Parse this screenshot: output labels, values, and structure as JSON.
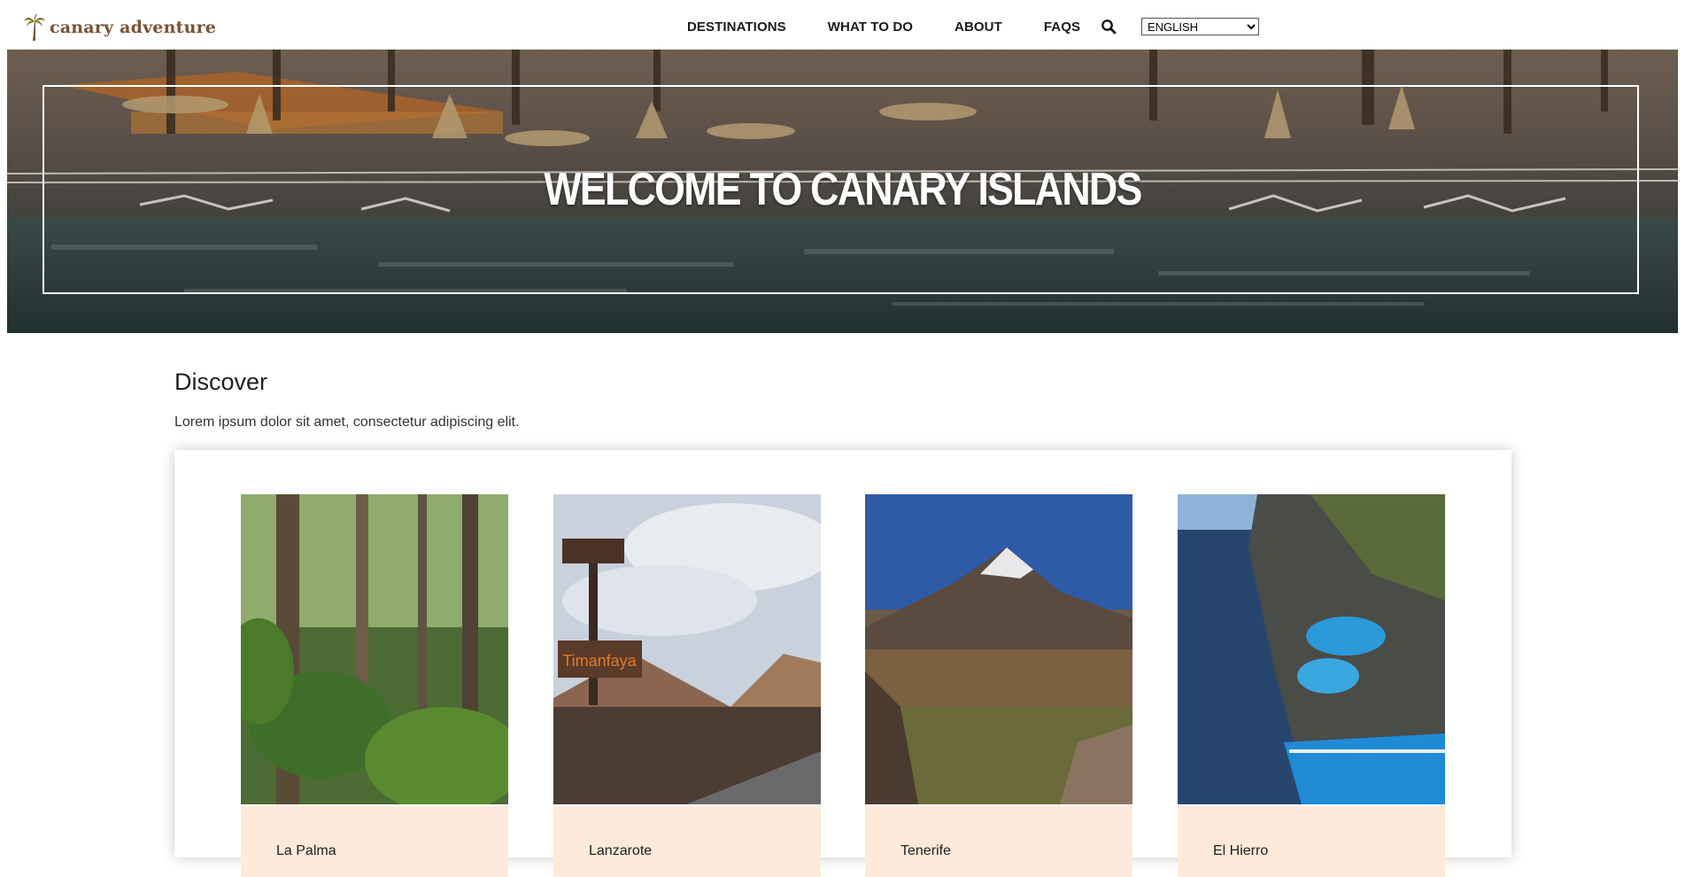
{
  "brand": {
    "name": "canary adventure",
    "logo_icon": "palm-tree-icon",
    "color": "#7a5232"
  },
  "nav": {
    "links": [
      "DESTINATIONS",
      "WHAT TO DO",
      "ABOUT",
      "FAQS"
    ],
    "search_icon": "search-icon",
    "language": {
      "selected": "ENGLISH"
    }
  },
  "hero": {
    "title": "WELCOME TO CANARY ISLANDS"
  },
  "discover": {
    "title": "Discover",
    "text": "Lorem ipsum dolor sit amet, consectetur adipiscing elit."
  },
  "cards": [
    {
      "label": "La Palma",
      "image": "forest-photo"
    },
    {
      "label": "Lanzarote",
      "image": "timanfaya-photo",
      "sign_text": "Timanfaya"
    },
    {
      "label": "Tenerife",
      "image": "teide-photo"
    },
    {
      "label": "El Hierro",
      "image": "coastal-pools-photo"
    }
  ],
  "colors": {
    "card_label_bg": "#fdeadb",
    "hero_frame": "#ffffff"
  }
}
